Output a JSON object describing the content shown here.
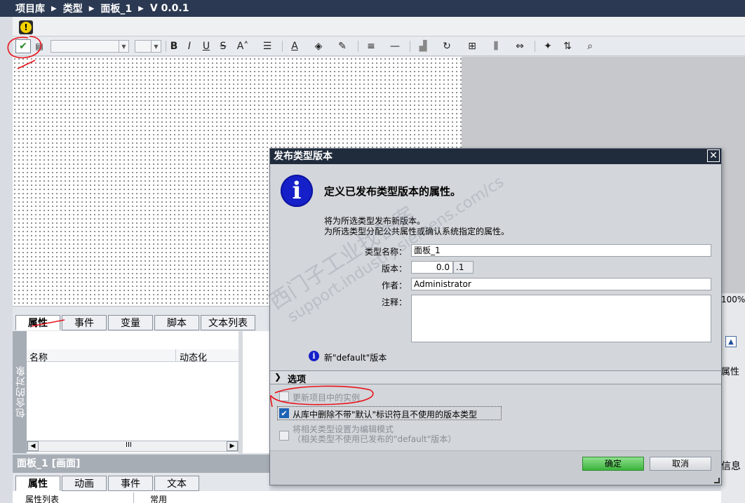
{
  "breadcrumb": [
    "项目库",
    "类型",
    "面板_1",
    "V 0.0.1"
  ],
  "toolbar": {
    "format_buttons": [
      "B",
      "I",
      "U",
      "S",
      "A"
    ],
    "style_combo_value": "",
    "size_combo_value": ""
  },
  "property_tabs": [
    "属性",
    "事件",
    "变量",
    "脚本",
    "文本列表"
  ],
  "side_label": "包含的对象",
  "grid": {
    "col_name": "名称",
    "col_dynamic": "动态化"
  },
  "scrollbar_thumb": "III",
  "lower_title": "面板_1 [画面]",
  "lower_tabs": [
    "属性",
    "动画",
    "事件",
    "文本"
  ],
  "bottom": {
    "item1": "属性列表",
    "item2": "常用"
  },
  "right_side": {
    "zoom": "100%",
    "prop": "属性",
    "info": "信息"
  },
  "dialog": {
    "title": "发布类型版本",
    "heading": "定义已发布类型版本的属性。",
    "desc1": "将为所选类型发布新版本。",
    "desc2": "为所选类型分配公共属性或确认系统指定的属性。",
    "type_name_label": "类型名称：",
    "type_name_value": "面板_1",
    "version_label": "版本：",
    "version_major": "0.0",
    "version_minor": ".1",
    "author_label": "作者：",
    "author_value": "Administrator",
    "comment_label": "注释：",
    "comment_value": "",
    "info_text": "新\"default\"版本",
    "options_label": "选项",
    "opt1": "更新项目中的实例",
    "opt2": "从库中删除不带\"默认\"标识符且不使用的版本类型",
    "opt3_line1": "将相关类型设置为编辑模式",
    "opt3_line2": "（相关类型不使用已发布的\"default\"版本）",
    "ok": "确定",
    "cancel": "取消"
  },
  "watermark": {
    "line1": "西门子工业找答案",
    "line2": "support.industry.siemens.com/cs"
  }
}
